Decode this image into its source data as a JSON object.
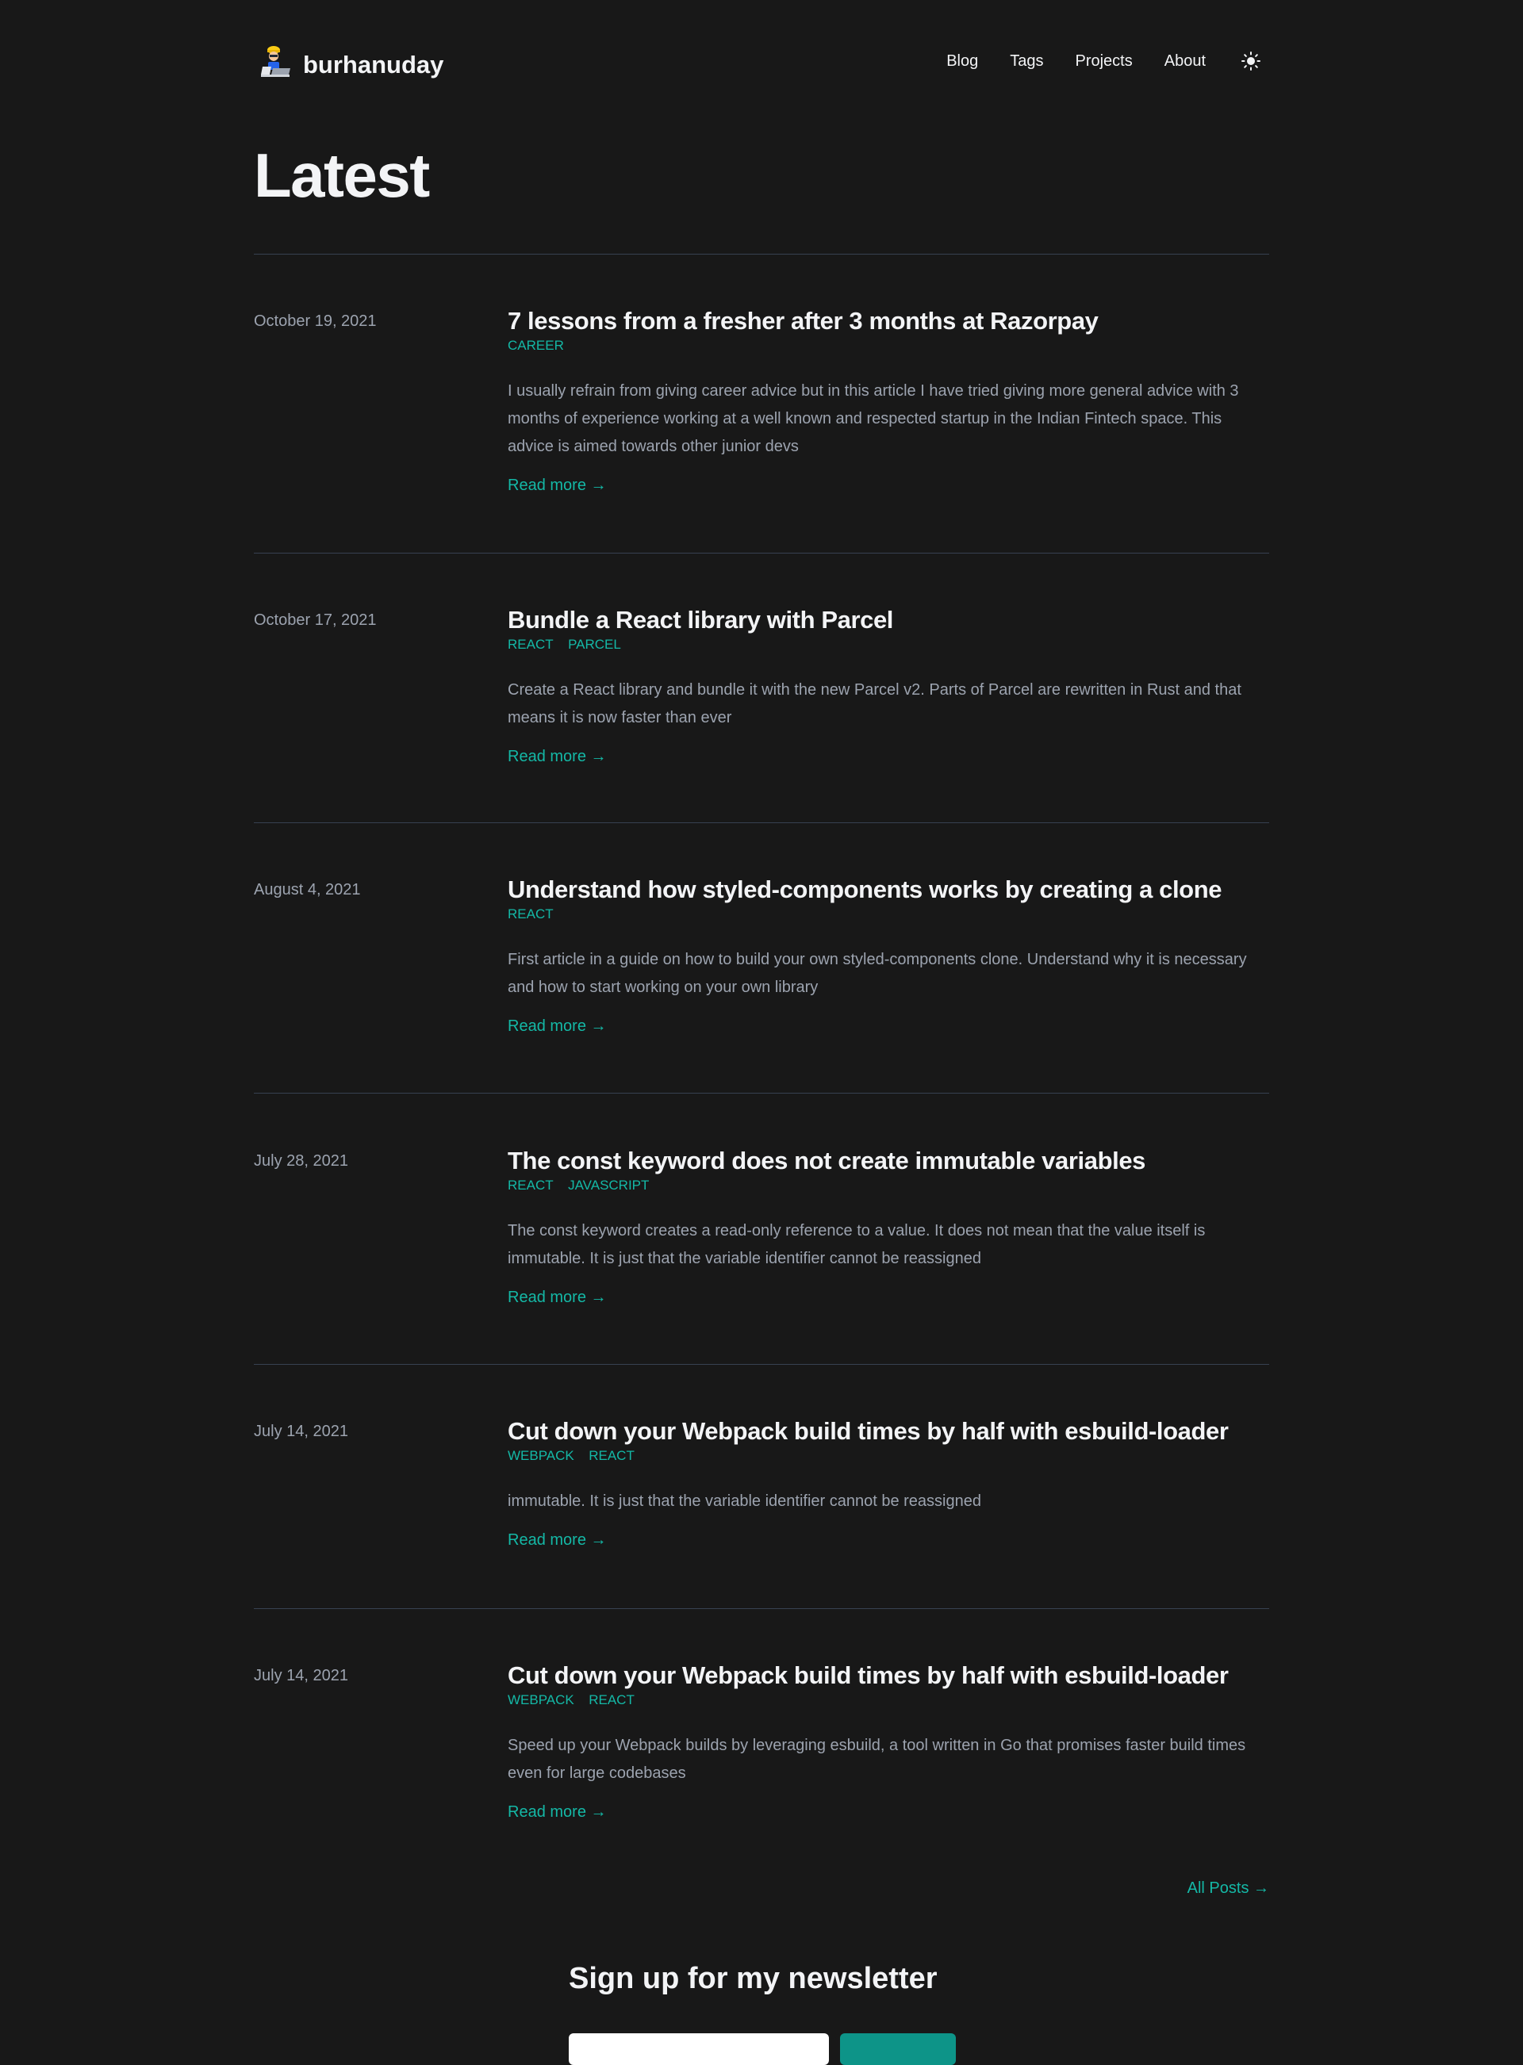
{
  "site": {
    "name": "burhanuday"
  },
  "nav": {
    "items": [
      {
        "label": "Blog"
      },
      {
        "label": "Tags"
      },
      {
        "label": "Projects"
      },
      {
        "label": "About"
      }
    ],
    "theme_icon": "sun-icon"
  },
  "page": {
    "title": "Latest"
  },
  "posts": [
    {
      "date": "October 19, 2021",
      "title": "7 lessons from a fresher after 3 months at Razorpay",
      "tags": [
        "CAREER"
      ],
      "summary": "I usually refrain from giving career advice but in this article I have tried giving more general advice with 3 months of experience working at a well known and respected startup in the Indian Fintech space. This advice is aimed towards other junior devs",
      "read_more": "Read more →"
    },
    {
      "date": "October 17, 2021",
      "title": "Bundle a React library with Parcel",
      "tags": [
        "REACT",
        "PARCEL"
      ],
      "summary": "Create a React library and bundle it with the new Parcel v2. Parts of Parcel are rewritten in Rust and that means it is now faster than ever",
      "read_more": "Read more →"
    },
    {
      "date": "August 4, 2021",
      "title": "Understand how styled-components works by creating a clone",
      "tags": [
        "REACT"
      ],
      "summary": "First article in a guide on how to build your own styled-components clone. Understand why it is necessary and how to start working on your own library",
      "read_more": "Read more →"
    },
    {
      "date": "July 28, 2021",
      "title": "The const keyword does not create immutable variables",
      "tags": [
        "REACT",
        "JAVASCRIPT"
      ],
      "summary": "The const keyword creates a read-only reference to a value. It does not mean that the value itself is immutable. It is just that the variable identifier cannot be reassigned",
      "read_more": "Read more →"
    },
    {
      "date": "July 14, 2021",
      "title": "Cut down your Webpack build times by half with esbuild-loader",
      "tags": [
        "WEBPACK",
        "REACT"
      ],
      "summary": "immutable. It is just that the variable identifier cannot be reassigned",
      "read_more": "Read more →"
    },
    {
      "date": "July 14, 2021",
      "title": "Cut down your Webpack build times by half with esbuild-loader",
      "tags": [
        "WEBPACK",
        "REACT"
      ],
      "summary": "Speed up your Webpack builds by leveraging esbuild, a tool written in Go that promises faster build times even for large codebases",
      "read_more": "Read more →"
    }
  ],
  "all_posts_label": "All Posts →",
  "newsletter": {
    "title": "Sign up for my newsletter"
  },
  "colors": {
    "background": "#181818",
    "accent": "#14b8a6",
    "text": "#f3f4f6",
    "muted": "#9ca3af"
  }
}
